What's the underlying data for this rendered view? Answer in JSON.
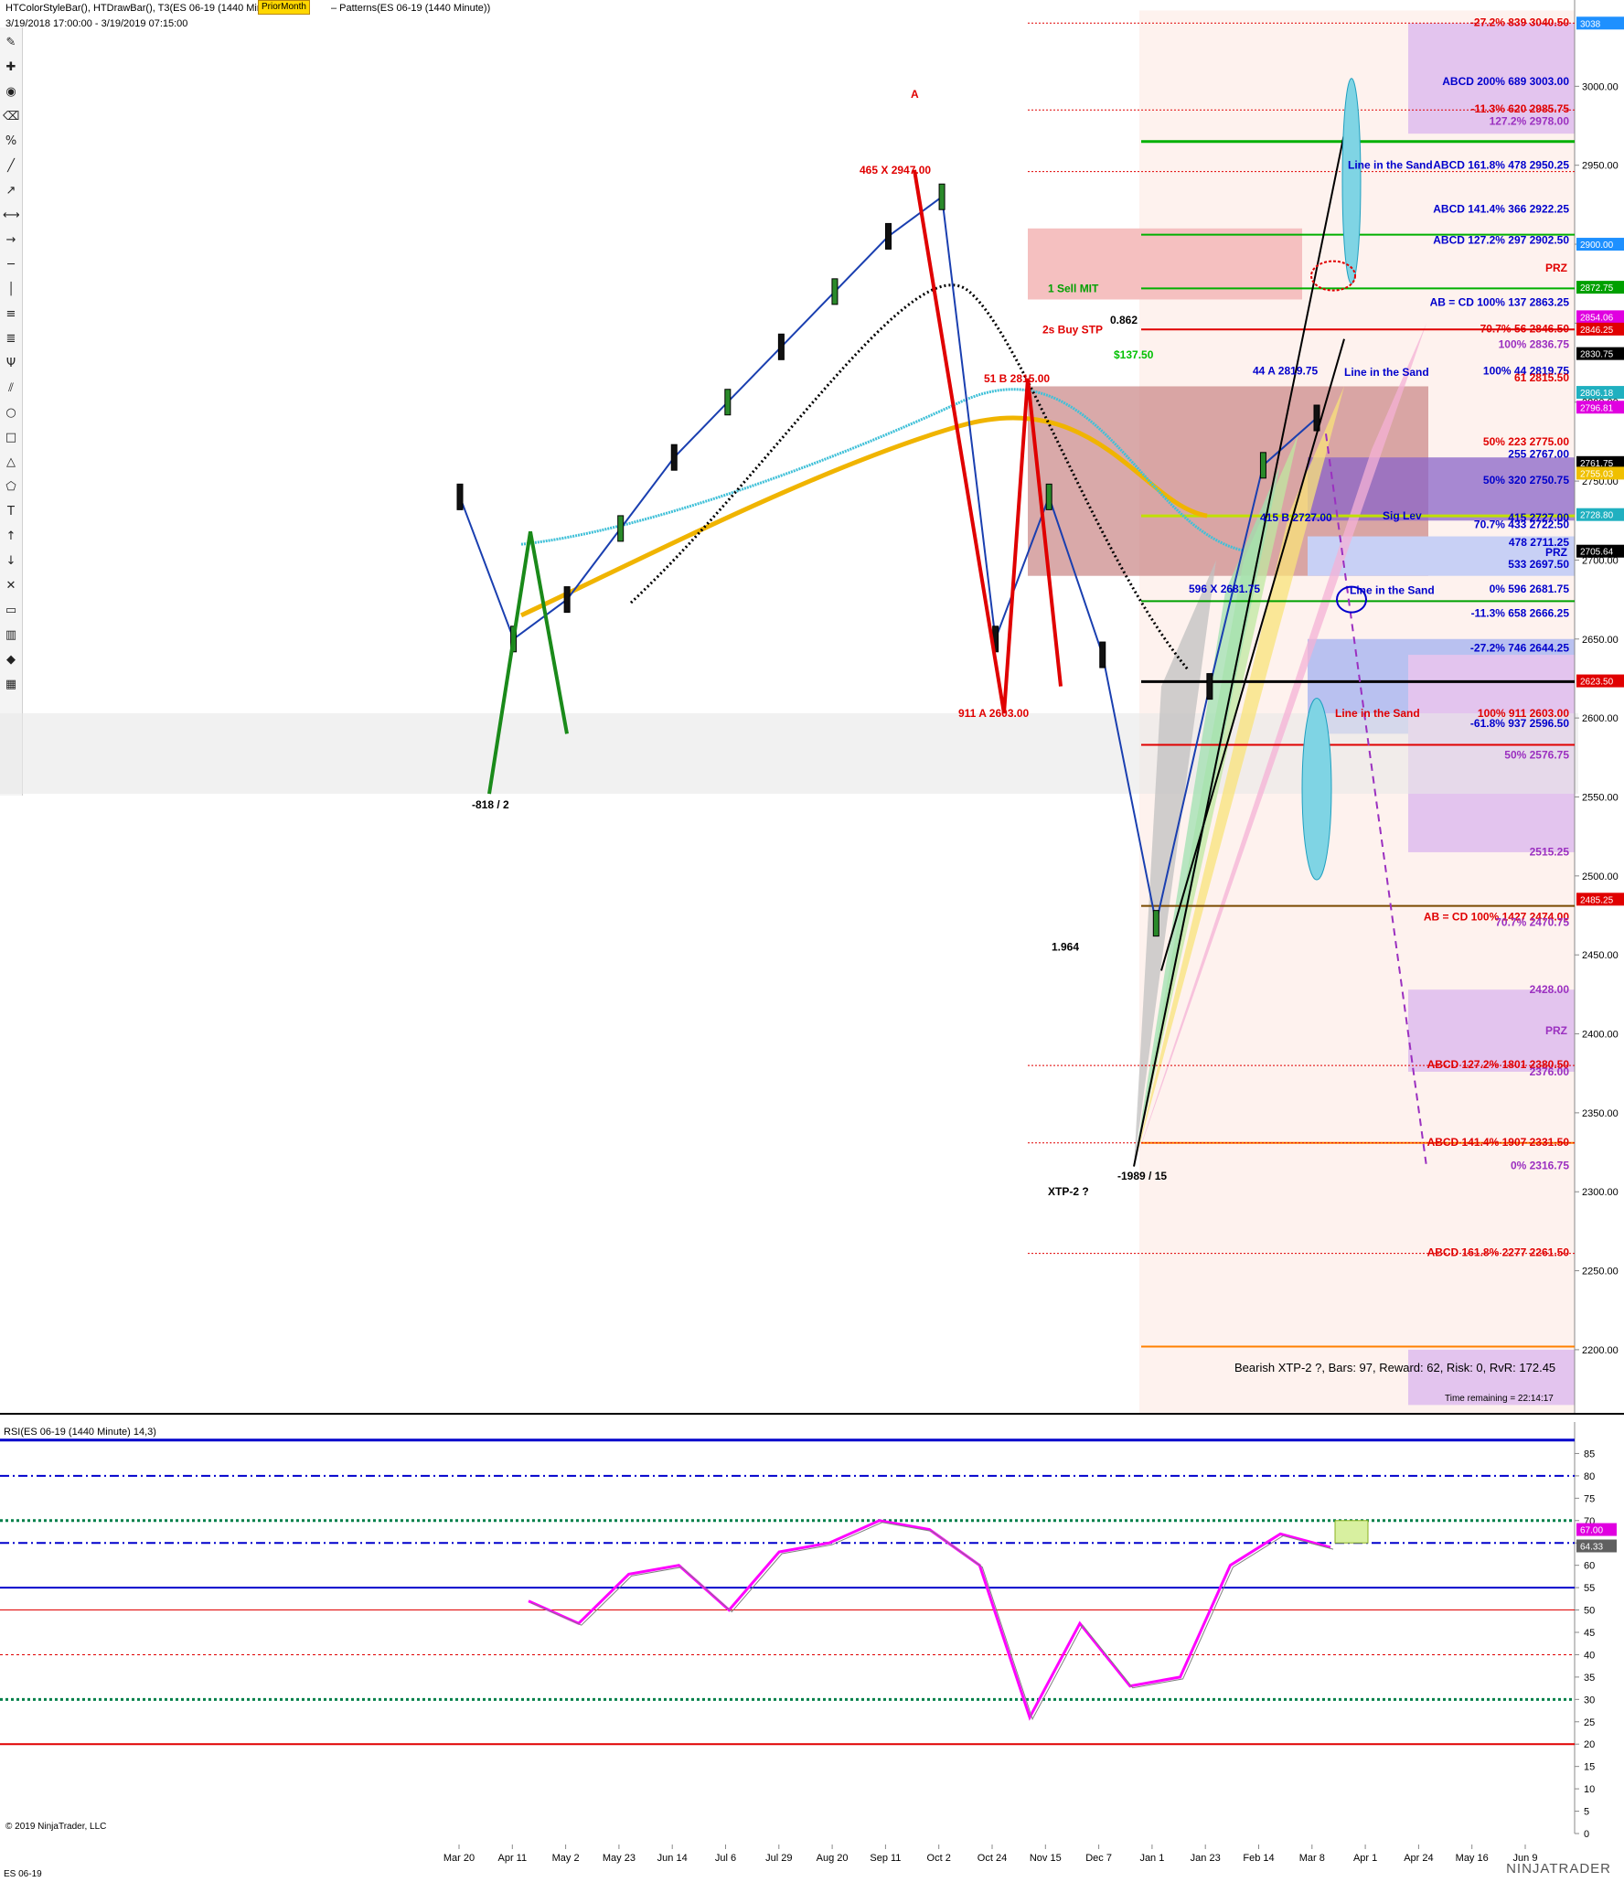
{
  "header": {
    "title": "HTColorStyleBar(), HTDrawBar(), T3(ES 06-19 (1440 Minute))",
    "badge": "PriorMonth",
    "title_tail": "– Patterns(ES 06-19 (1440 Minute))",
    "range": "3/19/2018 17:00:00 - 3/19/2019 07:15:00"
  },
  "toolbar": {
    "tools": [
      "pencil-icon",
      "crosshair-icon",
      "eye-icon",
      "eraser-icon",
      "percent-icon",
      "line-icon",
      "ray-icon",
      "extended-line-icon",
      "arrow-line-icon",
      "horizontal-line-icon",
      "vertical-line-icon",
      "fib-retracement-icon",
      "fib-extension-icon",
      "pitchfork-icon",
      "parallel-channel-icon",
      "ellipse-icon",
      "rectangle-icon",
      "triangle-icon",
      "polygon-icon",
      "text-icon",
      "arrow-up-icon",
      "arrow-down-icon",
      "x-mark-icon",
      "ruler-icon",
      "region-icon",
      "diamond-icon",
      "grid-icon"
    ]
  },
  "price_panel": {
    "ymin": 2160,
    "ymax": 3050,
    "ticks": [
      2200,
      2250,
      2300,
      2350,
      2400,
      2450,
      2500,
      2550,
      2600,
      2650,
      2700,
      2750,
      2800,
      2850,
      2900,
      2950,
      3000
    ],
    "dates": [
      "Mar 20",
      "Apr 11",
      "May 2",
      "May 23",
      "Jun 14",
      "Jul 6",
      "Jul 29",
      "Aug 20",
      "Sep 11",
      "Oct 2",
      "Oct 24",
      "Nov 15",
      "Dec 7",
      "Jan 1",
      "Jan 23",
      "Feb 14",
      "Mar 8",
      "Apr 1",
      "Apr 24",
      "May 16",
      "Jun 9"
    ],
    "price_tags": [
      {
        "text": "3038",
        "value": 3040,
        "color": "#1e90ff"
      },
      {
        "text": "2900.00",
        "value": 2900,
        "color": "#1e90ff"
      },
      {
        "text": "2872.75",
        "value": 2872.75,
        "color": "#00a000"
      },
      {
        "text": "2854.06",
        "value": 2854.06,
        "color": "#e000e0"
      },
      {
        "text": "2846.25",
        "value": 2846.25,
        "color": "#e00000"
      },
      {
        "text": "2830.75",
        "value": 2830.75,
        "color": "#000000"
      },
      {
        "text": "2806.18",
        "value": 2806.18,
        "color": "#20b0c0"
      },
      {
        "text": "2796.81",
        "value": 2796.81,
        "color": "#e000e0"
      },
      {
        "text": "2761.75",
        "value": 2761.75,
        "color": "#000000"
      },
      {
        "text": "2755.03",
        "value": 2755.03,
        "color": "#f0c000"
      },
      {
        "text": "2728.80",
        "value": 2728.8,
        "color": "#20b0c0"
      },
      {
        "text": "2705.64",
        "value": 2705.64,
        "color": "#000000"
      },
      {
        "text": "2623.50",
        "value": 2623.5,
        "color": "#e00000"
      },
      {
        "text": "2485.25",
        "value": 2485.25,
        "color": "#e00000"
      }
    ],
    "levels": [
      {
        "text": "-27.2%   839   3040.50",
        "value": 3040.5,
        "color": "#e00000"
      },
      {
        "text": "ABCD   200%   689   3003.00",
        "value": 3003,
        "color": "#0000cc"
      },
      {
        "text": "-11.3%   620   2985.75",
        "value": 2985.75,
        "color": "#e00000"
      },
      {
        "text": "127.2%   2978.00",
        "value": 2978,
        "color": "#9b30c0"
      },
      {
        "text": "ABCD   161.8%   478   2950.25",
        "value": 2950.25,
        "color": "#0000cc"
      },
      {
        "text": "ABCD   141.4%   366   2922.25",
        "value": 2922.25,
        "color": "#0000cc"
      },
      {
        "text": "ABCD   127.2%   297   2902.50",
        "value": 2902.5,
        "color": "#0000cc"
      },
      {
        "text": "AB = CD   100%   137   2863.25",
        "value": 2863.25,
        "color": "#0000cc"
      },
      {
        "text": "70.7%   56   2846.50",
        "value": 2846.5,
        "color": "#e00000"
      },
      {
        "text": "100%   2836.75",
        "value": 2836.75,
        "color": "#9b30c0"
      },
      {
        "text": "100%   44   2819.75",
        "value": 2819.75,
        "color": "#0000cc"
      },
      {
        "text": "61   2815.50",
        "value": 2815.5,
        "color": "#e00000"
      },
      {
        "text": "50%   223   2775.00",
        "value": 2775,
        "color": "#e00000"
      },
      {
        "text": "255   2767.00",
        "value": 2767,
        "color": "#0000cc"
      },
      {
        "text": "50%   320   2750.75",
        "value": 2750.75,
        "color": "#0000cc"
      },
      {
        "text": "415   2727.00",
        "value": 2727,
        "color": "#0000cc"
      },
      {
        "text": "70.7%   433   2722.50",
        "value": 2722.5,
        "color": "#0000cc"
      },
      {
        "text": "478   2711.25",
        "value": 2711.25,
        "color": "#0000cc"
      },
      {
        "text": "533   2697.50",
        "value": 2697.5,
        "color": "#0000cc"
      },
      {
        "text": "0%   596   2681.75",
        "value": 2681.75,
        "color": "#0000cc"
      },
      {
        "text": "-11.3%   658   2666.25",
        "value": 2666.25,
        "color": "#0000cc"
      },
      {
        "text": "-27.2%   746   2644.25",
        "value": 2644.25,
        "color": "#0000cc"
      },
      {
        "text": "100%   911   2603.00",
        "value": 2603,
        "color": "#e00000"
      },
      {
        "text": "-61.8%   937   2596.50",
        "value": 2596.5,
        "color": "#0000cc"
      },
      {
        "text": "50%   2576.75",
        "value": 2576.75,
        "color": "#9b30c0"
      },
      {
        "text": "2515.25",
        "value": 2515.25,
        "color": "#9b30c0"
      },
      {
        "text": "AB = CD   100%   1427   2474.00",
        "value": 2474,
        "color": "#e00000"
      },
      {
        "text": "70.7%   2470.75",
        "value": 2470.75,
        "color": "#9b30c0"
      },
      {
        "text": "2428.00",
        "value": 2428,
        "color": "#9b30c0"
      },
      {
        "text": "ABCD   127.2%   1801   2380.50",
        "value": 2380.5,
        "color": "#e00000"
      },
      {
        "text": "2376.00",
        "value": 2376,
        "color": "#9b30c0"
      },
      {
        "text": "ABCD   141.4%   1907   2331.50",
        "value": 2331.5,
        "color": "#e00000"
      },
      {
        "text": "0%   2316.75",
        "value": 2316.75,
        "color": "#9b30c0"
      },
      {
        "text": "ABCD   161.8%   2277   2261.50",
        "value": 2261.5,
        "color": "#e00000"
      }
    ],
    "notes": [
      {
        "text": "Line in the Sand",
        "value": 2950,
        "color": "#0000cc"
      },
      {
        "text": "Line in the Sand",
        "value": 2819,
        "color": "#0000cc"
      },
      {
        "text": "Line in the Sand",
        "value": 2681,
        "color": "#0000cc"
      },
      {
        "text": "Line in the Sand",
        "value": 2603,
        "color": "#e00000"
      },
      {
        "text": "Sig Lev",
        "value": 2728,
        "color": "#0000cc"
      },
      {
        "text": "PRZ",
        "value": 2885,
        "color": "#e00000"
      },
      {
        "text": "PRZ",
        "value": 2705,
        "color": "#0000cc"
      },
      {
        "text": "PRZ",
        "value": 2402,
        "color": "#9b30c0"
      },
      {
        "text": "465  X  2947.00",
        "value": 2947,
        "color": "#e00000"
      },
      {
        "text": "A",
        "value": 2995,
        "color": "#e00000"
      },
      {
        "text": "51  B  2815.00",
        "value": 2815,
        "color": "#e00000"
      },
      {
        "text": "911  A  2603.00",
        "value": 2603,
        "color": "#e00000"
      },
      {
        "text": "44  A  2819.75",
        "value": 2819.75,
        "color": "#0000cc"
      },
      {
        "text": "596  X  2681.75",
        "value": 2681.75,
        "color": "#0000cc"
      },
      {
        "text": "415  B  2727.00",
        "value": 2727,
        "color": "#0000cc"
      },
      {
        "text": "XTP-2 ?",
        "value": 2300,
        "color": "#000000"
      },
      {
        "text": "-1989 / 15",
        "value": 2310,
        "color": "#000000"
      },
      {
        "text": "-818 / 2",
        "value": 2545,
        "color": "#000000"
      },
      {
        "text": "1 Sell MIT",
        "value": 2872,
        "color": "#00a000"
      },
      {
        "text": "2s Buy STP",
        "value": 2846,
        "color": "#e00000"
      },
      {
        "text": "$137.50",
        "value": 2830,
        "color": "#00c000"
      },
      {
        "text": "0.862",
        "value": 2852,
        "color": "#000000"
      },
      {
        "text": "1.964",
        "value": 2455,
        "color": "#000000"
      }
    ],
    "info": "Bearish XTP-2 ?, Bars: 97, Reward: 62, Risk: 0, RvR: 172.45",
    "time_remaining": "Time remaining = 22:14:17"
  },
  "rsi_panel": {
    "title": "RSI(ES 06-19 (1440 Minute) 14,3)",
    "ymin": 0,
    "ymax": 90,
    "ticks": [
      0,
      5,
      10,
      15,
      20,
      25,
      30,
      35,
      40,
      45,
      50,
      55,
      60,
      65,
      70,
      75,
      80,
      85
    ],
    "current": "64.33",
    "last": "67.00"
  },
  "chart_data": {
    "type": "line",
    "title": "ES 06-19 (1440 Minute)",
    "x": [
      "Mar 20",
      "Apr 11",
      "May 2",
      "May 23",
      "Jun 14",
      "Jul 6",
      "Jul 29",
      "Aug 20",
      "Sep 11",
      "Oct 2",
      "Oct 24",
      "Nov 15",
      "Dec 7",
      "Jan 1",
      "Jan 23",
      "Feb 14",
      "Mar 8"
    ],
    "series": [
      {
        "name": "ES 06-19",
        "values": [
          2740,
          2650,
          2675,
          2720,
          2765,
          2800,
          2835,
          2870,
          2905,
          2930,
          2650,
          2740,
          2640,
          2470,
          2620,
          2760,
          2790
        ]
      },
      {
        "name": "RSI",
        "values": [
          52,
          47,
          58,
          60,
          50,
          63,
          65,
          70,
          68,
          60,
          26,
          47,
          33,
          35,
          60,
          67,
          64
        ]
      }
    ],
    "ylim": [
      2160,
      3050
    ]
  },
  "footer": {
    "copyright": "© 2019 NinjaTrader, LLC",
    "symbol": "ES 06-19",
    "logo": "NINJATRADER"
  }
}
